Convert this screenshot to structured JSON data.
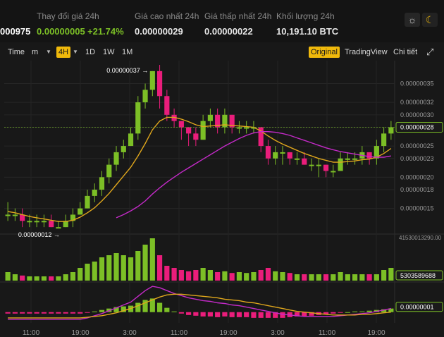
{
  "stats": {
    "last_price_partial": "000975",
    "change_label": "Thay đổi giá 24h",
    "change_value": "0.00000005",
    "change_percent": "+21.74%",
    "high_label": "Giá cao nhất 24h",
    "high_value": "0.00000029",
    "low_label": "Giá thấp nhất 24h",
    "low_value": "0.00000022",
    "volume_label": "Khối lượng 24h",
    "volume_value": "10,191.10 BTC"
  },
  "toolbar": {
    "time_label": "Time",
    "minute_label": "m",
    "interval_4h": "4H",
    "interval_1d": "1D",
    "interval_1w": "1W",
    "interval_1m": "1M",
    "view_original": "Original",
    "view_tradingview": "TradingView",
    "view_detail": "Chi tiết",
    "icon_theme_light": "sun-icon",
    "icon_theme_dark": "moon-icon",
    "icon_fullscreen": "expand-icon",
    "caret_icon": "caret-down-icon"
  },
  "colors": {
    "up": "#7cbf26",
    "down": "#ea1d7b",
    "ma_fast": "#e0a71c",
    "ma_slow": "#c42ac8",
    "accent": "#f0b90b"
  },
  "chart_data": {
    "type": "candlestick",
    "price_axis": {
      "ticks": [
        "0.00000035",
        "0.00000032",
        "0.00000030",
        "0.00000028",
        "0.00000025",
        "0.00000023",
        "0.00000020",
        "0.00000018",
        "0.00000015"
      ],
      "current_price": "0.00000028",
      "max_marker": "0.00000037",
      "min_marker": "0.00000012"
    },
    "volume_axis": {
      "top_label": "41530013290.00",
      "current_label": "5303589688"
    },
    "indicator_axis": {
      "current_label": "0.00000001"
    },
    "time_labels": [
      "11:00",
      "19:00",
      "3:00",
      "11:00",
      "19:00",
      "3:00",
      "11:00",
      "19:00"
    ],
    "candles": [
      [
        14,
        14,
        16,
        13
      ],
      [
        14,
        14,
        15,
        13
      ],
      [
        14,
        13,
        15,
        12
      ],
      [
        13,
        13,
        14,
        12
      ],
      [
        13,
        13,
        14,
        12
      ],
      [
        13,
        13,
        14,
        12
      ],
      [
        13,
        12,
        14,
        12
      ],
      [
        12,
        12,
        13,
        12
      ],
      [
        12,
        13,
        14,
        12
      ],
      [
        13,
        14,
        15,
        12
      ],
      [
        14,
        15,
        16,
        14
      ],
      [
        15,
        17,
        18,
        15
      ],
      [
        17,
        18,
        19,
        16
      ],
      [
        18,
        20,
        21,
        17
      ],
      [
        20,
        22,
        23,
        19
      ],
      [
        22,
        24,
        25,
        21
      ],
      [
        24,
        25,
        26,
        23
      ],
      [
        25,
        27,
        28,
        25
      ],
      [
        27,
        32,
        33,
        26
      ],
      [
        32,
        34,
        35,
        31
      ],
      [
        34,
        37,
        37,
        33
      ],
      [
        37,
        33,
        38,
        31
      ],
      [
        33,
        30,
        34,
        29
      ],
      [
        30,
        29,
        31,
        28
      ],
      [
        29,
        28,
        29,
        26
      ],
      [
        28,
        27,
        28,
        25
      ],
      [
        27,
        26,
        28,
        25
      ],
      [
        26,
        29,
        30,
        26
      ],
      [
        29,
        30,
        31,
        28
      ],
      [
        30,
        28,
        31,
        27
      ],
      [
        28,
        30,
        31,
        27
      ],
      [
        30,
        28,
        30,
        27
      ],
      [
        28,
        28,
        29,
        27
      ],
      [
        28,
        28,
        29,
        27
      ],
      [
        28,
        28,
        29,
        27
      ],
      [
        28,
        25,
        28,
        24
      ],
      [
        25,
        23,
        26,
        22
      ],
      [
        23,
        24,
        25,
        22
      ],
      [
        24,
        24,
        25,
        22
      ],
      [
        24,
        23,
        24,
        22
      ],
      [
        23,
        23,
        24,
        22
      ],
      [
        23,
        22,
        24,
        22
      ],
      [
        22,
        22,
        23,
        21
      ],
      [
        22,
        22,
        23,
        20
      ],
      [
        22,
        21,
        22,
        20
      ],
      [
        21,
        21,
        22,
        20
      ],
      [
        21,
        23,
        24,
        21
      ],
      [
        23,
        23,
        24,
        22
      ],
      [
        23,
        23,
        24,
        22
      ],
      [
        23,
        24,
        25,
        22
      ],
      [
        24,
        23,
        24,
        22
      ],
      [
        23,
        25,
        26,
        22
      ],
      [
        25,
        27,
        28,
        24
      ],
      [
        27,
        28,
        29,
        26
      ]
    ],
    "ma_fast": [
      14.5,
      14.3,
      14.0,
      13.7,
      13.5,
      13.3,
      13.1,
      12.9,
      12.9,
      13.1,
      13.6,
      14.3,
      15.1,
      16.2,
      17.4,
      18.8,
      20.2,
      21.6,
      23.4,
      25.4,
      27.6,
      29.0,
      29.6,
      29.6,
      29.3,
      28.9,
      28.4,
      28.1,
      28.2,
      28.3,
      28.4,
      28.3,
      28.2,
      28.1,
      28.0,
      27.4,
      26.6,
      25.9,
      25.3,
      24.8,
      24.3,
      23.8,
      23.4,
      23.0,
      22.7,
      22.4,
      22.4,
      22.5,
      22.6,
      22.8,
      22.9,
      23.2,
      23.8,
      24.6
    ],
    "ma_slow": [
      null,
      null,
      null,
      null,
      null,
      null,
      null,
      null,
      null,
      null,
      null,
      null,
      null,
      null,
      null,
      13.5,
      14.0,
      14.6,
      15.3,
      16.2,
      17.3,
      18.3,
      19.2,
      20.0,
      20.8,
      21.5,
      22.2,
      22.9,
      23.6,
      24.3,
      25.0,
      25.6,
      26.2,
      26.7,
      27.1,
      27.3,
      27.3,
      27.2,
      27.0,
      26.7,
      26.3,
      25.9,
      25.5,
      25.1,
      24.7,
      24.4,
      24.1,
      23.9,
      23.7,
      23.5,
      23.3,
      23.2,
      23.2,
      23.4
    ],
    "volumes": [
      20,
      15,
      12,
      10,
      10,
      10,
      10,
      10,
      15,
      20,
      30,
      40,
      45,
      55,
      60,
      65,
      60,
      55,
      70,
      85,
      100,
      60,
      35,
      30,
      25,
      22,
      25,
      30,
      25,
      20,
      22,
      18,
      20,
      18,
      20,
      25,
      30,
      22,
      20,
      18,
      15,
      15,
      15,
      15,
      15,
      15,
      20,
      15,
      15,
      15,
      15,
      15,
      25,
      30
    ],
    "indicator_macd": [
      -1,
      -1,
      -1,
      -1,
      -1,
      -1,
      -1,
      -1,
      -1,
      -1,
      -1,
      -0.8,
      -0.5,
      -0.2,
      0.2,
      0.6,
      1.0,
      1.4,
      2.2,
      3.0,
      3.6,
      3.4,
      3.0,
      2.6,
      2.3,
      2.0,
      1.8,
      1.6,
      1.5,
      1.3,
      1.2,
      1.0,
      0.9,
      0.7,
      0.5,
      0.3,
      0.1,
      -0.1,
      -0.3,
      -0.4,
      -0.5,
      -0.6,
      -0.6,
      -0.6,
      -0.6,
      -0.6,
      -0.5,
      -0.4,
      -0.3,
      -0.2,
      -0.1,
      0.1,
      0.3,
      0.5
    ],
    "indicator_signal": [
      -0.8,
      -0.8,
      -0.8,
      -0.8,
      -0.8,
      -0.8,
      -0.8,
      -0.8,
      -0.8,
      -0.8,
      -0.8,
      -0.7,
      -0.6,
      -0.5,
      -0.3,
      -0.1,
      0.2,
      0.5,
      0.9,
      1.3,
      1.7,
      2.1,
      2.4,
      2.5,
      2.5,
      2.4,
      2.3,
      2.2,
      2.1,
      2.0,
      1.8,
      1.7,
      1.6,
      1.4,
      1.3,
      1.1,
      0.9,
      0.7,
      0.5,
      0.3,
      0.1,
      0.0,
      -0.1,
      -0.2,
      -0.3,
      -0.4,
      -0.4,
      -0.4,
      -0.4,
      -0.3,
      -0.3,
      -0.2,
      -0.1,
      0.0
    ]
  }
}
